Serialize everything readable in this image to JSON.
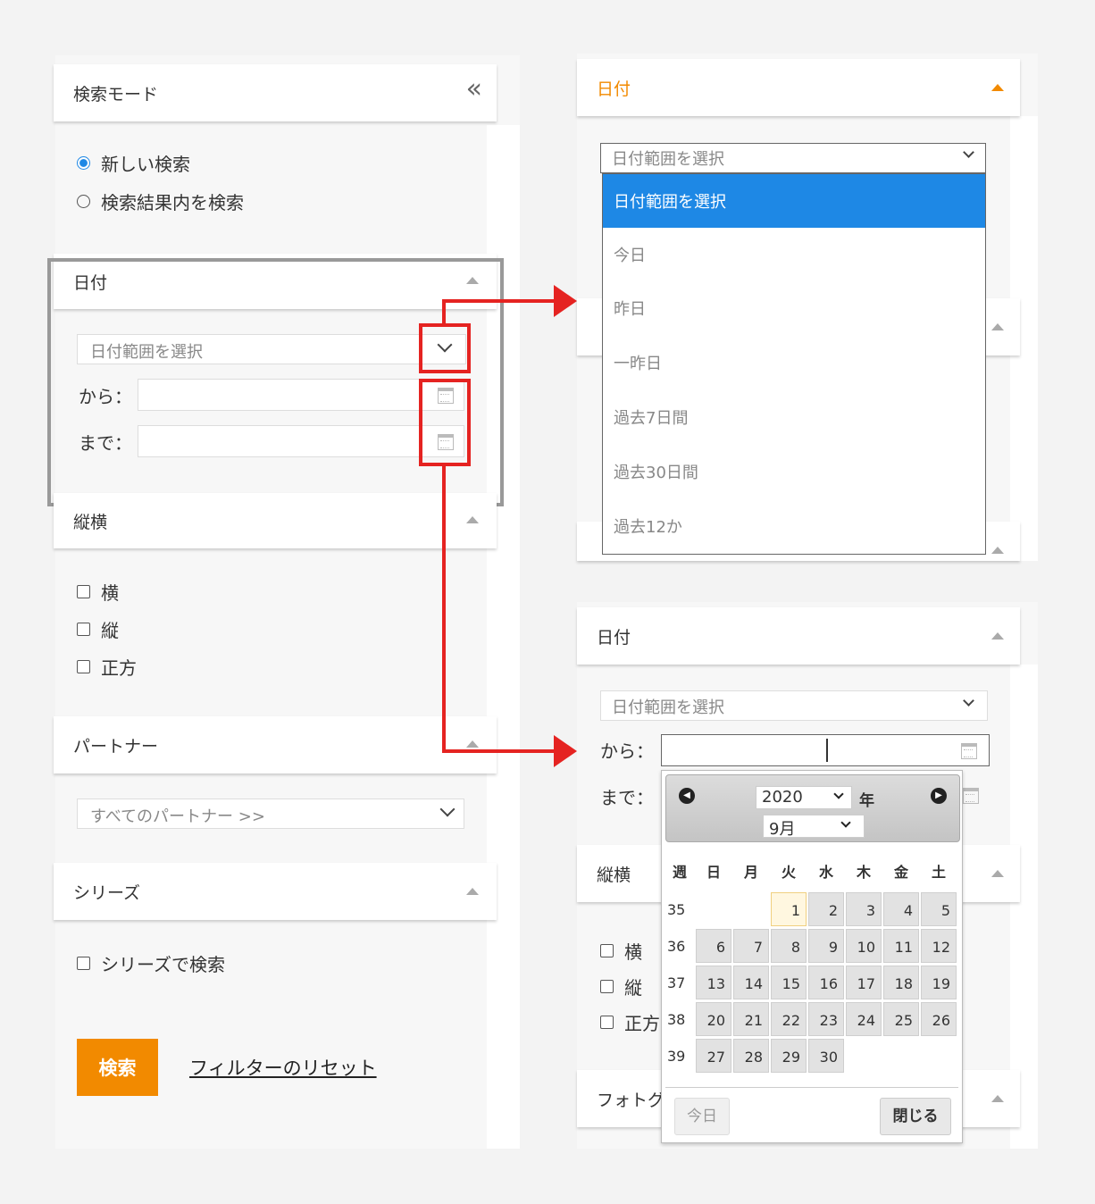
{
  "left": {
    "search_mode_title": "検索モード",
    "collapse_symbol": "«",
    "search_mode_options": [
      {
        "label": "新しい検索",
        "selected": true
      },
      {
        "label": "検索結果内を検索",
        "selected": false
      }
    ],
    "date_title": "日付",
    "date_range_placeholder": "日付範囲を選択",
    "from_label": "から：",
    "to_label": "まで：",
    "orientation_title": "縦横",
    "orientation_options": [
      "横",
      "縦",
      "正方"
    ],
    "partner_title": "パートナー",
    "partner_placeholder": "すべてのパートナー >>",
    "series_title": "シリーズ",
    "series_option": "シリーズで検索",
    "search_button": "検索",
    "reset_link": "フィルターのリセット"
  },
  "dropdown_panel": {
    "title": "日付",
    "select_value": "日付範囲を選択",
    "options": [
      "日付範囲を選択",
      "今日",
      "昨日",
      "一昨日",
      "過去7日間",
      "過去30日間",
      "過去12か"
    ],
    "selected_index": 0
  },
  "calendar_panel": {
    "title": "日付",
    "select_value": "日付範囲を選択",
    "from_label": "から：",
    "to_label": "まで：",
    "orientation_title": "縦横",
    "orientation_options": [
      "横",
      "縦",
      "正方"
    ],
    "photo_title_partial": "フォトグ",
    "year": "2020",
    "year_suffix": "年",
    "month": "9月",
    "week_header": "週",
    "weekdays": [
      "日",
      "月",
      "火",
      "水",
      "木",
      "金",
      "土"
    ],
    "weeks": [
      {
        "wk": "35",
        "days": [
          "",
          "",
          "1",
          "2",
          "3",
          "4",
          "5"
        ]
      },
      {
        "wk": "36",
        "days": [
          "6",
          "7",
          "8",
          "9",
          "10",
          "11",
          "12"
        ]
      },
      {
        "wk": "37",
        "days": [
          "13",
          "14",
          "15",
          "16",
          "17",
          "18",
          "19"
        ]
      },
      {
        "wk": "38",
        "days": [
          "20",
          "21",
          "22",
          "23",
          "24",
          "25",
          "26"
        ]
      },
      {
        "wk": "39",
        "days": [
          "27",
          "28",
          "29",
          "30",
          "",
          "",
          ""
        ]
      }
    ],
    "today_day": "1",
    "today_button": "今日",
    "close_button": "閉じる"
  },
  "colors": {
    "accent_orange": "#f28a00",
    "highlight_red": "#e52321",
    "selected_blue": "#1e88e5"
  }
}
